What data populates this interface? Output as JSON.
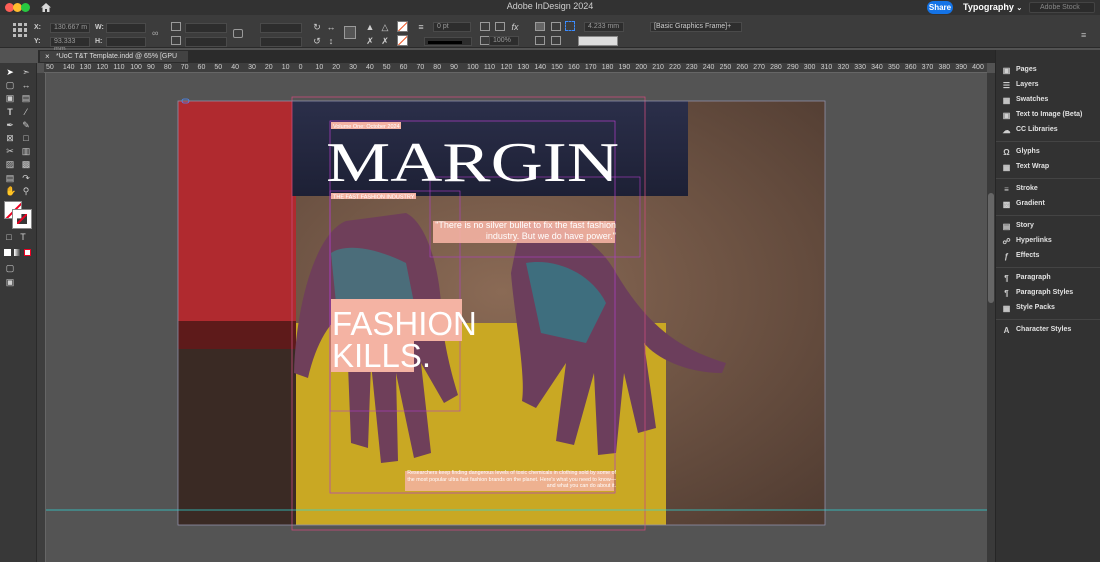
{
  "titlebar": {
    "app_title": "Adobe InDesign 2024",
    "share_label": "Share",
    "workspace_label": "Typography",
    "stock_placeholder": "Adobe Stock"
  },
  "control": {
    "x_label": "X:",
    "x_value": "130.667 m",
    "y_label": "Y:",
    "y_value": "93.333 mm",
    "w_label": "W:",
    "h_label": "H:",
    "stroke_weight": "0 pt",
    "zoom_percent": "100%",
    "gap_value": "4.233 mm",
    "frame_style": "[Basic Graphics Frame]+"
  },
  "document": {
    "tab_title": "*UoC T&T Template.indd @ 65% [GPU Preview]"
  },
  "ruler": {
    "h_ticks": [
      "50",
      "140",
      "130",
      "120",
      "110",
      "100",
      "90",
      "80",
      "70",
      "60",
      "50",
      "40",
      "30",
      "20",
      "10",
      "0",
      "10",
      "20",
      "30",
      "40",
      "50",
      "60",
      "70",
      "80",
      "90",
      "100",
      "110",
      "120",
      "130",
      "140",
      "150",
      "160",
      "170",
      "180",
      "190",
      "200",
      "210",
      "220",
      "230",
      "240",
      "250",
      "260",
      "270",
      "280",
      "290",
      "300",
      "310",
      "320",
      "330",
      "340",
      "350",
      "360",
      "370",
      "380",
      "390",
      "400"
    ]
  },
  "panels": [
    {
      "label": "Pages",
      "icon": "pages-icon"
    },
    {
      "label": "Layers",
      "icon": "layers-icon"
    },
    {
      "label": "Swatches",
      "icon": "swatches-icon"
    },
    {
      "label": "Text to Image (Beta)",
      "icon": "text-to-image-icon"
    },
    {
      "label": "CC Libraries",
      "icon": "cc-libraries-icon"
    },
    {
      "label": "Glyphs",
      "icon": "glyphs-icon"
    },
    {
      "label": "Text Wrap",
      "icon": "text-wrap-icon"
    },
    {
      "label": "Stroke",
      "icon": "stroke-icon"
    },
    {
      "label": "Gradient",
      "icon": "gradient-icon"
    },
    {
      "label": "Story",
      "icon": "story-icon"
    },
    {
      "label": "Hyperlinks",
      "icon": "hyperlinks-icon"
    },
    {
      "label": "Effects",
      "icon": "effects-icon"
    },
    {
      "label": "Paragraph",
      "icon": "paragraph-icon"
    },
    {
      "label": "Paragraph Styles",
      "icon": "paragraph-styles-icon"
    },
    {
      "label": "Style Packs",
      "icon": "style-packs-icon"
    },
    {
      "label": "Character Styles",
      "icon": "character-styles-icon"
    }
  ],
  "layout_page": {
    "issue_line": "Volume One: October 2024",
    "masthead": "MARGIN",
    "tagline": "THE FAST FASHION INDUSTRY",
    "quote": "\"There is no silver bullet to fix the fast fashion industry. But we do have power.\"",
    "headline_1": "FASHION",
    "headline_2": "KILLS.",
    "body_text": "Researchers keep finding dangerous levels of toxic chemicals in clothing sold by some of the most popular ultra fast fashion brands on the planet. Here's what you need to know—and what you can do about it."
  },
  "colors": {
    "accent_pink": "#f4b3a3",
    "guide_magenta": "#b03ec8",
    "guide_cyan": "#2fd6d6"
  }
}
